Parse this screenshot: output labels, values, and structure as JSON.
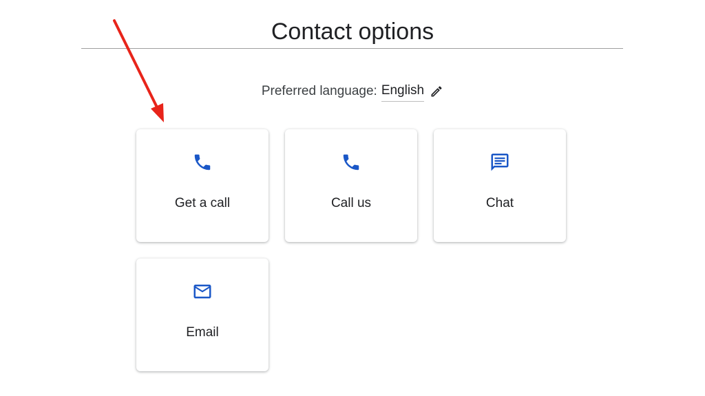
{
  "page": {
    "title": "Contact options"
  },
  "language": {
    "label": "Preferred language:",
    "value": "English",
    "edit_icon": "pencil-icon"
  },
  "options": [
    {
      "label": "Get a call",
      "icon": "phone-icon"
    },
    {
      "label": "Call us",
      "icon": "phone-icon"
    },
    {
      "label": "Chat",
      "icon": "chat-icon"
    },
    {
      "label": "Email",
      "icon": "email-icon"
    }
  ],
  "colors": {
    "accent": "#1a57c7",
    "text": "#202124",
    "annotation_arrow": "#e8241a",
    "divider": "#9e9e9e"
  }
}
